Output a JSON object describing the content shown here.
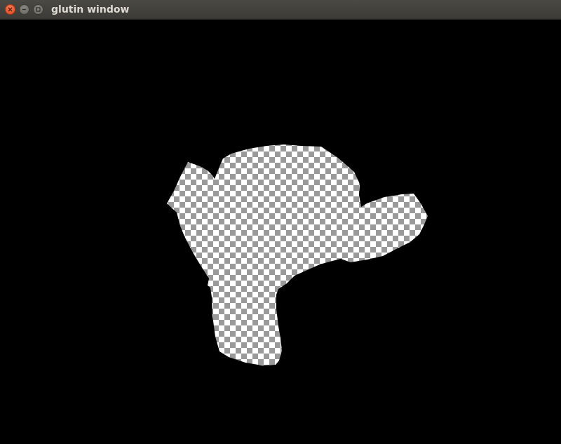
{
  "window": {
    "title": "glutin window",
    "background_color": "#000000"
  },
  "titlebar": {
    "buttons": [
      {
        "name": "close",
        "icon": "close-icon",
        "color": "#e0491d"
      },
      {
        "name": "minimize",
        "icon": "minimize-icon",
        "color": "#66655f"
      },
      {
        "name": "maximize",
        "icon": "maximize-icon",
        "color": "#66655f"
      }
    ]
  },
  "scene": {
    "object": "monkey-head-silhouette",
    "texture": "checkerboard",
    "texture_colors": [
      "#ffffff",
      "#9a9a9a"
    ]
  }
}
